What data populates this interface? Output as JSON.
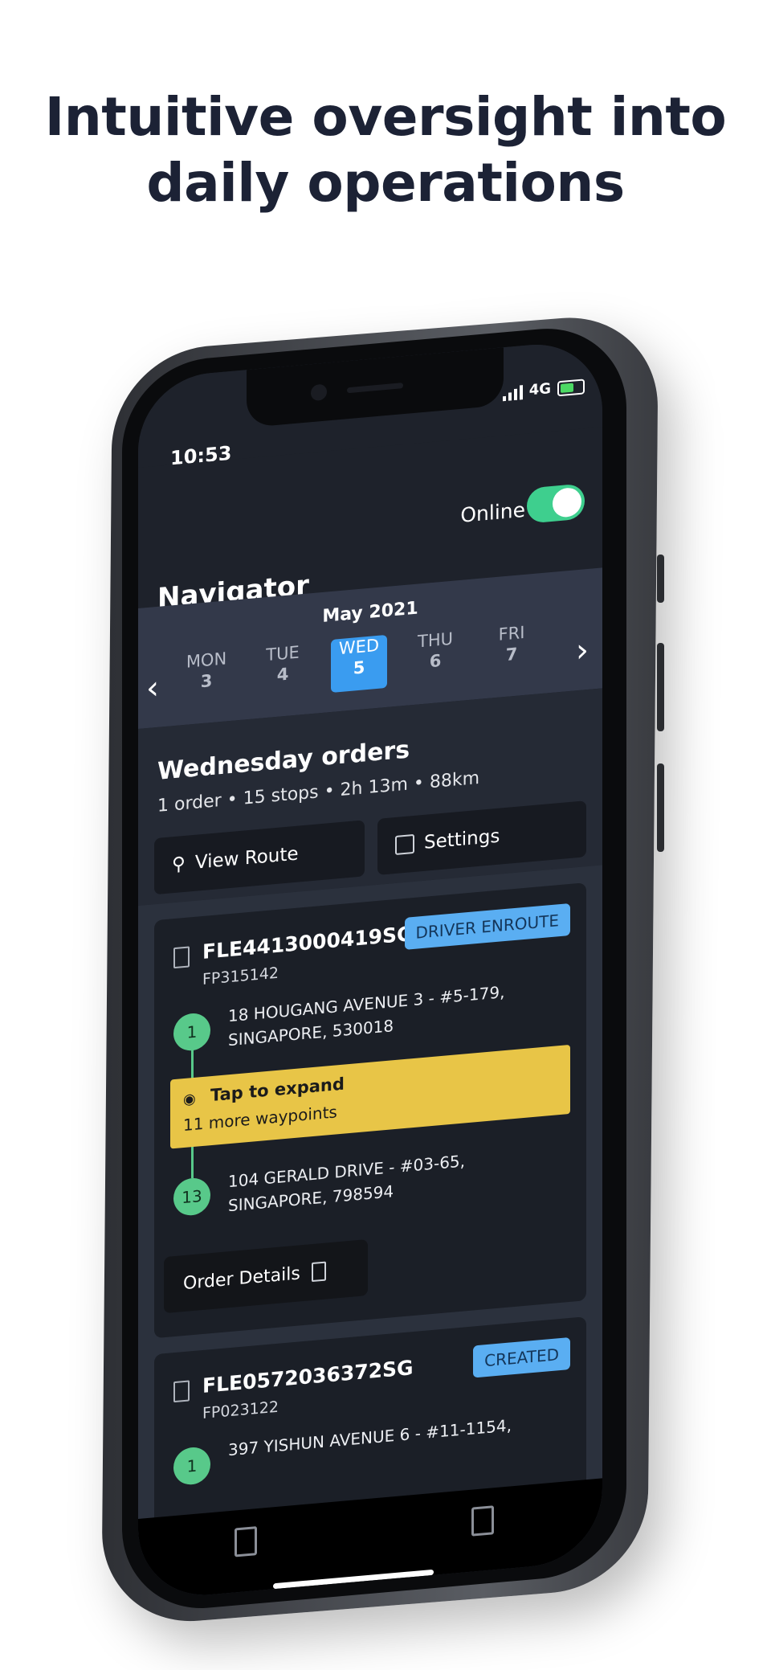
{
  "headline": {
    "line1": "Intuitive oversight into",
    "line2": "daily operations"
  },
  "status": {
    "time": "10:53",
    "network": "4G"
  },
  "header": {
    "title": "Navigator",
    "online_label": "Online",
    "online": true
  },
  "calendar": {
    "month": "May 2021",
    "days": [
      {
        "name": "MON",
        "num": "3"
      },
      {
        "name": "TUE",
        "num": "4"
      },
      {
        "name": "WED",
        "num": "5",
        "active": true
      },
      {
        "name": "THU",
        "num": "6"
      },
      {
        "name": "FRI",
        "num": "7"
      }
    ]
  },
  "summary": {
    "title": "Wednesday orders",
    "subtitle": "1 order  •  15 stops  •  2h 13m  •  88km",
    "view_route": "View Route",
    "settings": "Settings"
  },
  "orders": [
    {
      "id": "FLE4413000419SG",
      "ref": "FP315142",
      "status": "DRIVER ENROUTE",
      "first_stop": {
        "num": "1",
        "address": "18 HOUGANG AVENUE 3 - #5-179, SINGAPORE, 530018"
      },
      "expand": {
        "title": "Tap to expand",
        "subtitle": "11 more waypoints"
      },
      "last_stop": {
        "num": "13",
        "address": "104 GERALD DRIVE - #03-65, SINGAPORE, 798594"
      },
      "details_label": "Order Details"
    },
    {
      "id": "FLE0572036372SG",
      "ref": "FP023122",
      "status": "CREATED",
      "first_stop": {
        "num": "1",
        "address": "397 YISHUN AVENUE 6 - #11-1154,"
      }
    }
  ],
  "colors": {
    "accent": "#3a9cf0",
    "toggle": "#3ecf8e",
    "expand": "#e8c547",
    "stop": "#58c98a"
  }
}
